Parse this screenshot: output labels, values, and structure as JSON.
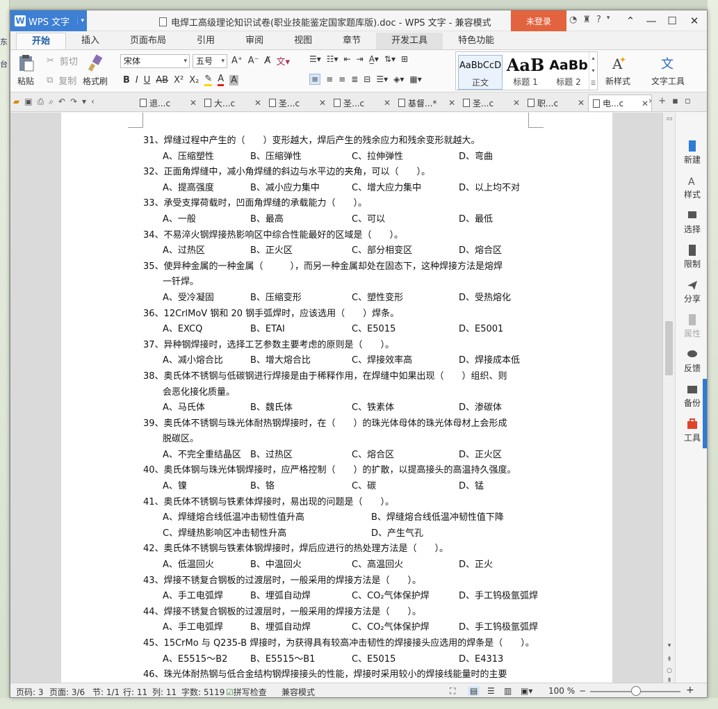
{
  "desktop": {
    "left_fragments": [
      "东",
      "台"
    ]
  },
  "titlebar": {
    "app_menu": "WPS 文字",
    "app_logo": "W",
    "title": "电焊工高级理论知识试卷(职业技能鉴定国家题库版).doc - WPS 文字 - 兼容模式",
    "login": "未登录",
    "help": "?"
  },
  "tabs": [
    "开始",
    "插入",
    "页面布局",
    "引用",
    "审阅",
    "视图",
    "章节",
    "开发工具",
    "特色功能"
  ],
  "ribbon": {
    "paste": "粘贴",
    "cut": "剪切",
    "copy": "复制",
    "format_painter": "格式刷",
    "font_name": "宋体",
    "font_size": "五号",
    "styles": [
      {
        "preview": "AaBbCcD",
        "name": "正文"
      },
      {
        "preview": "AaB",
        "name": "标题 1"
      },
      {
        "preview": "AaBb",
        "name": "标题 2"
      }
    ],
    "new_style": "新样式",
    "text_tools": "文字工具"
  },
  "doc_tabs": [
    "退...c",
    "大...c",
    "圣...c",
    "圣...c",
    "基督...*",
    "圣...c",
    "职...c",
    "电...c"
  ],
  "questions": [
    {
      "q": "31、焊缝过程中产生的（　　）变形越大，焊后产生的残余应力和残余变形就越大。",
      "opts": [
        "A、压缩塑性",
        "B、压缩弹性",
        "C、拉伸弹性",
        "D、弯曲"
      ]
    },
    {
      "q": "32、正面角焊缝中，减小角焊缝的斜边与水平边的夹角，可以（　　）。",
      "opts": [
        "A、提高强度",
        "B、减小应力集中",
        "C、增大应力集中",
        "D、以上均不对"
      ]
    },
    {
      "q": "33、承受支撑荷载时，凹面角焊缝的承载能力（　　）。",
      "opts": [
        "A、一般",
        "B、最高",
        "C、可以",
        "D、最低"
      ]
    },
    {
      "q": "34、不易淬火钢焊接热影响区中综合性能最好的区域是（　　）。",
      "opts": [
        "A、过热区",
        "B、正火区",
        "C、部分相变区",
        "D、熔合区"
      ]
    },
    {
      "q": "35、使异种金属的一种金属（　　　），而另一种金属却处在固态下，这种焊接方法是熔焊",
      "cont": "一钎焊。",
      "opts": [
        "A、受冷凝固",
        "B、压缩变形",
        "C、塑性变形",
        "D、受热熔化"
      ]
    },
    {
      "q": "36、12CrlMoV 钢和 20 钢手弧焊时，应该选用（　　）焊条。",
      "opts": [
        "A、EXCQ",
        "B、ETAI",
        "C、E5015",
        "D、E5001"
      ]
    },
    {
      "q": "37、异种钢焊接时，选择工艺参数主要考虑的原则是（　　）。",
      "opts": [
        "A、减小熔合比",
        "B、增大熔合比",
        "C、焊接效率高",
        "D、焊接成本低"
      ]
    },
    {
      "q": "38、奥氏体不锈钢与低碳钢进行焊接是由于稀释作用，在焊缝中如果出现（　　）组织、则",
      "cont": "会恶化接化质量。",
      "opts": [
        "A、马氏体",
        "B、魏氏体",
        "C、铁素体",
        "D、渗碳体"
      ]
    },
    {
      "q": "39、奥氏体不锈钢与珠光体耐热钢焊接时，在（　　）的珠光体母体的珠光体母材上会形成",
      "cont": "脱碳区。",
      "opts": [
        "A、不完全重结晶区",
        "B、过热区",
        "C、熔合区",
        "D、正火区"
      ]
    },
    {
      "q": "40、奥氏体钢与珠光体钢焊接时，应严格控制（　　）的扩散，以提高接头的高温持久强度。",
      "opts": [
        "A、镍",
        "B、铬",
        "C、碳",
        "D、锰"
      ]
    },
    {
      "q": "41、奥氏体不锈钢与铁素体焊接时，易出现的问题是（　　）。",
      "opts2": [
        [
          "A、焊缝熔合线低温冲击韧性值升高",
          "B、焊缝熔合线低温冲韧性值下降"
        ],
        [
          "C、焊缝热影响区冲击韧性升高",
          "D、产生气孔"
        ]
      ]
    },
    {
      "q": "42、奥氏体不锈钢与铁素体钢焊接时，焊后应进行的热处理方法是（　　）。",
      "opts": [
        "A、低温回火",
        "B、中温回火",
        "C、高温回火",
        "D、正火"
      ]
    },
    {
      "q": "43、焊接不锈复合钢板的过渡层时，一般采用的焊接方法是（　　）。",
      "opts": [
        "A、手工电弧焊",
        "B、埋弧自动焊",
        "C、CO₂气体保护焊",
        "D、手工钨极氩弧焊"
      ]
    },
    {
      "q": "44、焊接不锈复合钢板的过渡层时，一般采用的焊接方法是（　　）。",
      "opts": [
        "A、手工电弧焊",
        "B、埋弧自动焊",
        "C、CO₂气体保护焊",
        "D、手工钨极氩弧焊"
      ]
    },
    {
      "q": "45、15CrMo 与 Q235-B 焊接时，为获得具有较高冲击韧性的焊接接头应选用的焊条是（　　）。",
      "opts": [
        "A、E5515～B2",
        "B、E5515～B1",
        "C、E5015",
        "D、E4313"
      ]
    },
    {
      "q": "46、珠光体耐热钢与低合金结构钢焊接接头的性能，焊接时采用较小的焊接线能量时的主要"
    }
  ],
  "right_panel": [
    "新建",
    "样式",
    "选择",
    "限制",
    "分享",
    "属性",
    "反馈",
    "备份",
    "工具"
  ],
  "status": {
    "page": "页码: 3",
    "pages": "页面: 3/6",
    "section": "节: 1/1",
    "row": "行: 11",
    "col": "列: 11",
    "words": "字数: 5119",
    "spell": "拼写检查",
    "compat": "兼容模式",
    "zoom": "100 %"
  },
  "colors": {
    "app_blue": "#3d7fd4",
    "login_orange": "#e2633d",
    "accent_blue": "#2f7bd6"
  }
}
